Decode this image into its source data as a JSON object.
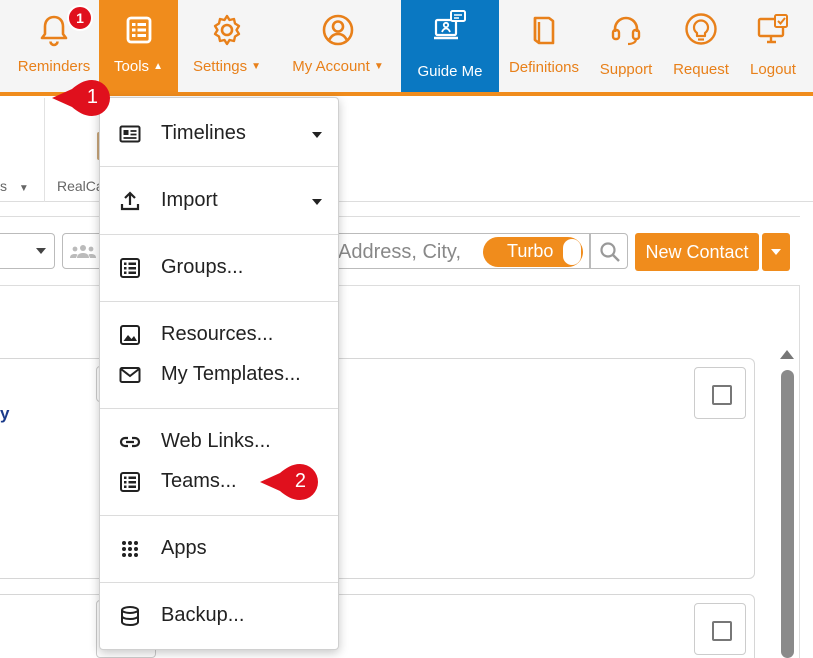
{
  "nav": {
    "reminders_label": "Reminders",
    "reminders_badge": "1",
    "tools_label": "Tools",
    "settings_label": "Settings",
    "my_account_label": "My Account",
    "guide_me_label": "Guide Me",
    "definitions_label": "Definitions",
    "support_label": "Support",
    "request_label": "Request",
    "logout_label": "Logout"
  },
  "ribbon": {
    "left_label_fragment": "s",
    "realcal_fragment": "RealCa"
  },
  "search": {
    "placeholder_fragment": "Address, City,",
    "turbo_label": "Turbo",
    "new_contact_label": "New Contact"
  },
  "list": {
    "name_fragment": "y"
  },
  "tools_menu": {
    "items": [
      {
        "label": "Timelines",
        "icon": "timeline-icon",
        "has_submenu": true
      },
      {
        "label": "Import",
        "icon": "upload-icon",
        "has_submenu": true
      },
      {
        "label": "Groups...",
        "icon": "list-icon",
        "has_submenu": false
      },
      {
        "label": "Resources...",
        "icon": "image-icon",
        "has_submenu": false
      },
      {
        "label": "My Templates...",
        "icon": "envelope-icon",
        "has_submenu": false
      },
      {
        "label": "Web Links...",
        "icon": "link-icon",
        "has_submenu": false
      },
      {
        "label": "Teams...",
        "icon": "list-icon",
        "has_submenu": false
      },
      {
        "label": "Apps",
        "icon": "grid-dots-icon",
        "has_submenu": false
      },
      {
        "label": "Backup...",
        "icon": "database-icon",
        "has_submenu": false
      }
    ]
  },
  "callouts": {
    "step1": "1",
    "step2": "2"
  },
  "colors": {
    "accent": "#f08c1c",
    "guide_blue": "#0a78c2",
    "callout_red": "#e0101d"
  }
}
